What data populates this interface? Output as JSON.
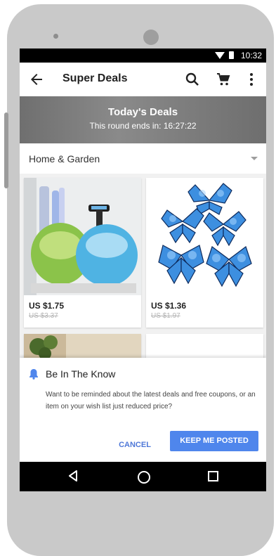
{
  "status_bar": {
    "time": "10:32"
  },
  "toolbar": {
    "title": "Super Deals"
  },
  "banner": {
    "title": "Today's Deals",
    "subtitle": "This round ends in: 16:27:22"
  },
  "category": {
    "selected": "Home & Garden"
  },
  "products": [
    {
      "price": "US $1.75",
      "old_price": "US $3.37"
    },
    {
      "price": "US $1.36",
      "old_price": "US $1.97"
    }
  ],
  "dialog": {
    "title": "Be In The Know",
    "body": "Want to be reminded about the latest deals and free coupons, or an item on your wish list just reduced price?",
    "cancel_label": "CANCEL",
    "confirm_label": "KEEP ME POSTED"
  },
  "colors": {
    "accent": "#4f86ec",
    "banner": "#7a7a7a",
    "bell": "#4f86ec"
  },
  "icons": [
    "back-arrow-icon",
    "search-icon",
    "cart-icon",
    "more-vert-icon",
    "chevron-down-icon",
    "bell-icon",
    "nav-back-icon",
    "nav-home-icon",
    "nav-recents-icon"
  ]
}
